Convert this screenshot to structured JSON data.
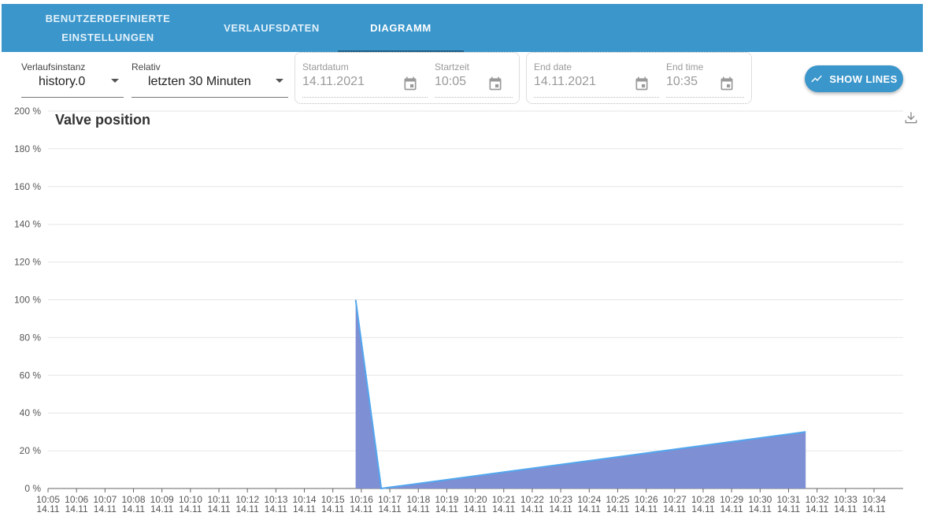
{
  "tabs": [
    {
      "label_line1": "BENUTZERDEFINIERTE",
      "label_line2": "EINSTELLUNGEN",
      "active": false
    },
    {
      "label": "VERLAUFSDATEN",
      "active": false
    },
    {
      "label": "DIAGRAMM",
      "active": true
    }
  ],
  "toolbar": {
    "instance": {
      "label": "Verlaufsinstanz",
      "value": "history.0"
    },
    "relative": {
      "label": "Relativ",
      "value": "letzten 30 Minuten"
    },
    "start_date": {
      "label": "Startdatum",
      "value": "14.11.2021"
    },
    "start_time": {
      "label": "Startzeit",
      "value": "10:05"
    },
    "end_date": {
      "label": "End date",
      "value": "14.11.2021"
    },
    "end_time": {
      "label": "End time",
      "value": "10:35"
    },
    "show_lines_label": "SHOW LINES",
    "show_lines_icon": "show-chart-icon"
  },
  "icons": {
    "calendar": "calendar-icon",
    "download": "download-icon",
    "dropdown": "chevron-down-icon"
  },
  "colors": {
    "accent": "#3a96cb",
    "area_fill": "#7f8fd3",
    "line": "#52a7ee"
  },
  "chart_data": {
    "type": "area",
    "title": "Valve position",
    "ylim": [
      0,
      200
    ],
    "y_ticks": [
      "0 %",
      "20 %",
      "40 %",
      "60 %",
      "80 %",
      "100 %",
      "120 %",
      "140 %",
      "160 %",
      "180 %",
      "200 %"
    ],
    "x_ticks": [
      {
        "time": "10:05",
        "date": "14.11"
      },
      {
        "time": "10:06",
        "date": "14.11"
      },
      {
        "time": "10:07",
        "date": "14.11"
      },
      {
        "time": "10:08",
        "date": "14.11"
      },
      {
        "time": "10:09",
        "date": "14.11"
      },
      {
        "time": "10:10",
        "date": "14.11"
      },
      {
        "time": "10:11",
        "date": "14.11"
      },
      {
        "time": "10:12",
        "date": "14.11"
      },
      {
        "time": "10:13",
        "date": "14.11"
      },
      {
        "time": "10:14",
        "date": "14.11"
      },
      {
        "time": "10:15",
        "date": "14.11"
      },
      {
        "time": "10:16",
        "date": "14.11"
      },
      {
        "time": "10:17",
        "date": "14.11"
      },
      {
        "time": "10:18",
        "date": "14.11"
      },
      {
        "time": "10:19",
        "date": "14.11"
      },
      {
        "time": "10:20",
        "date": "14.11"
      },
      {
        "time": "10:21",
        "date": "14.11"
      },
      {
        "time": "10:22",
        "date": "14.11"
      },
      {
        "time": "10:23",
        "date": "14.11"
      },
      {
        "time": "10:24",
        "date": "14.11"
      },
      {
        "time": "10:25",
        "date": "14.11"
      },
      {
        "time": "10:26",
        "date": "14.11"
      },
      {
        "time": "10:27",
        "date": "14.11"
      },
      {
        "time": "10:28",
        "date": "14.11"
      },
      {
        "time": "10:29",
        "date": "14.11"
      },
      {
        "time": "10:30",
        "date": "14.11"
      },
      {
        "time": "10:31",
        "date": "14.11"
      },
      {
        "time": "10:32",
        "date": "14.11"
      },
      {
        "time": "10:33",
        "date": "14.11"
      },
      {
        "time": "10:34",
        "date": "14.11"
      }
    ],
    "x_range": [
      "10:05",
      "10:34"
    ],
    "series": [
      {
        "x": [
          "10:15:48",
          "10:16:42",
          "10:31:36"
        ],
        "y": [
          100,
          0,
          30
        ]
      }
    ],
    "grid": true
  }
}
